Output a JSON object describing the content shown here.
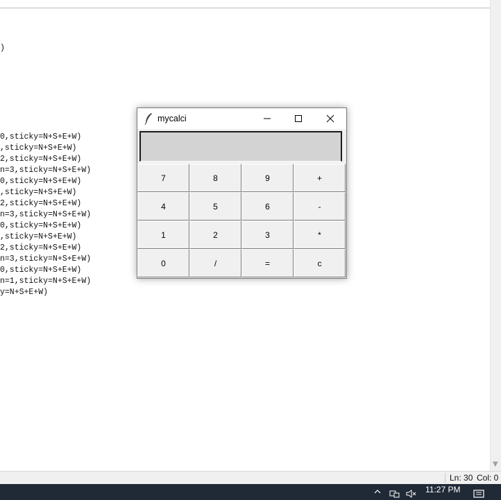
{
  "editor": {
    "lines": [
      ")",
      "0,sticky=N+S+E+W)",
      ",sticky=N+S+E+W)",
      "2,sticky=N+S+E+W)",
      "n=3,sticky=N+S+E+W)",
      "0,sticky=N+S+E+W)",
      ",sticky=N+S+E+W)",
      "2,sticky=N+S+E+W)",
      "n=3,sticky=N+S+E+W)",
      "0,sticky=N+S+E+W)",
      ",sticky=N+S+E+W)",
      "2,sticky=N+S+E+W)",
      "n=3,sticky=N+S+E+W)",
      "0,sticky=N+S+E+W)",
      "n=1,sticky=N+S+E+W)",
      "y=N+S+E+W)"
    ]
  },
  "statusbar": {
    "line": "Ln: 30",
    "column": "Col: 0"
  },
  "taskbar": {
    "time": "11:27 PM"
  },
  "calc": {
    "title": "mycalci",
    "display_value": "",
    "keys": [
      [
        "7",
        "8",
        "9",
        "+"
      ],
      [
        "4",
        "5",
        "6",
        "-"
      ],
      [
        "1",
        "2",
        "3",
        "*"
      ],
      [
        "0",
        "/",
        "=",
        "c"
      ]
    ]
  }
}
